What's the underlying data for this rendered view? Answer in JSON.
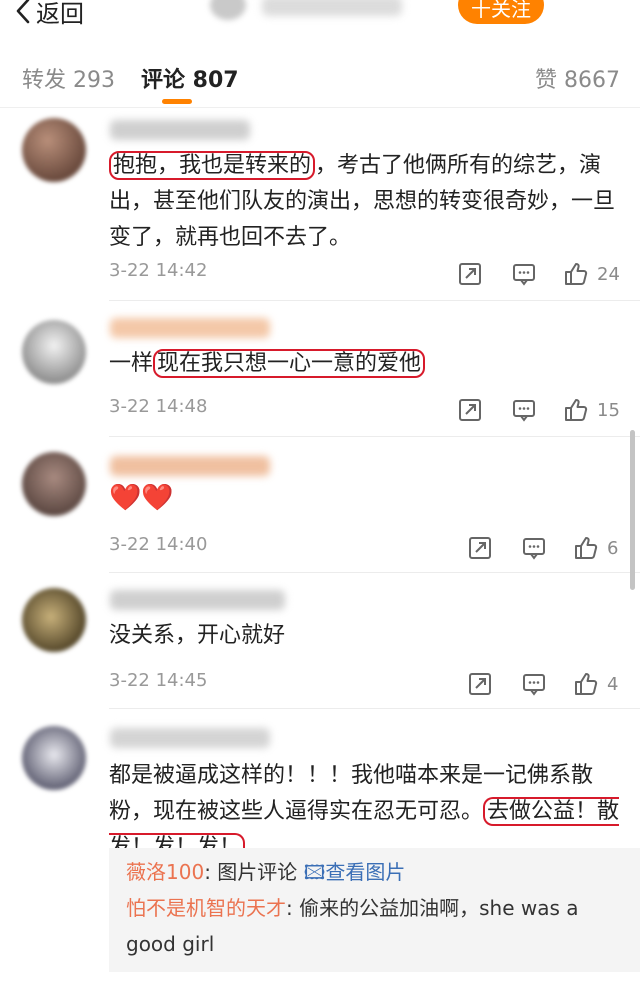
{
  "nav": {
    "back_label": "返回",
    "follow_label": "十关注"
  },
  "tabs": {
    "repost": "转发 293",
    "comment": "评论 807",
    "like": "赞 8667"
  },
  "comments": [
    {
      "text_highlight": "抱抱，我也是转来的",
      "text_rest": "，考古了他俩所有的综艺，演出，甚至他们队友的演出，思想的转变很奇妙，一旦变了，就再也回不去了。",
      "time": "3-22 14:42",
      "likes": "24"
    },
    {
      "text_prefix": "一样",
      "text_highlight": "现在我只想一心一意的爱他",
      "time": "3-22 14:48",
      "likes": "15"
    },
    {
      "text": "❤️❤️",
      "time": "3-22 14:40",
      "likes": "6"
    },
    {
      "text": "没关系，开心就好",
      "time": "3-22 14:45",
      "likes": "4"
    },
    {
      "text_rest": "都是被逼成这样的！！！我他喵本来是一记佛系散粉，现在被这些人逼得实在忍无可忍。",
      "text_highlight": "去做公益！散发！发！发！",
      "time": "",
      "likes": "",
      "replies": [
        {
          "name": "薇洛100",
          "text": ": 图片评论 ",
          "link": "🖾查看图片"
        },
        {
          "name": "怕不是机智的天才",
          "text": ": 偷来的公益加油啊，she was a good girl",
          "link": ""
        }
      ]
    }
  ],
  "colors": {
    "accent": "#ff8200",
    "highlight_box": "#d71a2b",
    "reply_name": "#eb7350",
    "reply_link": "#3b6fb6"
  }
}
